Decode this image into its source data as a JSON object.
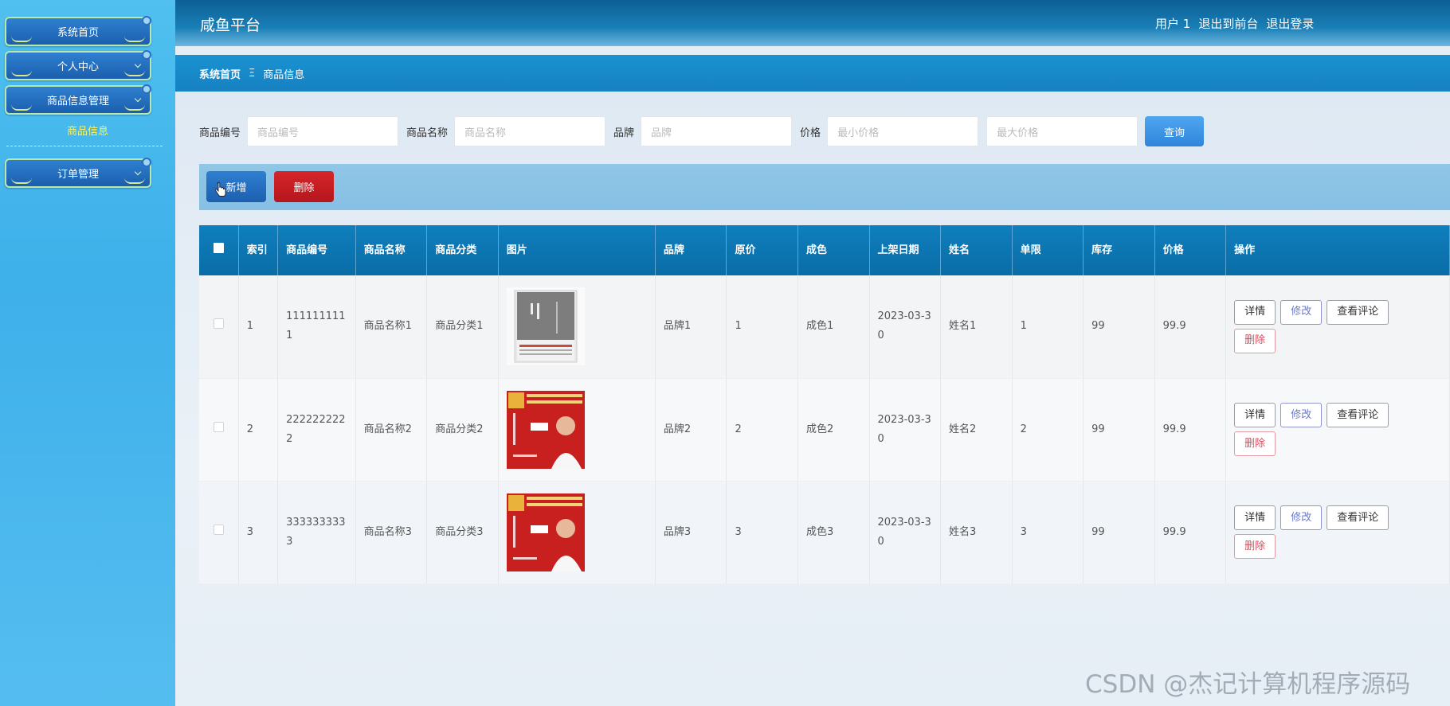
{
  "sidebar": {
    "items": [
      {
        "label": "系统首页"
      },
      {
        "label": "个人中心"
      },
      {
        "label": "商品信息管理"
      },
      {
        "label": "订单管理"
      }
    ],
    "submenu": {
      "label": "商品信息"
    }
  },
  "header": {
    "title": "咸鱼平台",
    "user": "用户 1",
    "to_front": "退出到前台",
    "logout": "退出登录"
  },
  "breadcrumb": {
    "home": "系统首页",
    "separator": "Ξ",
    "current": "商品信息"
  },
  "search": {
    "code_label": "商品编号",
    "code_placeholder": "商品编号",
    "name_label": "商品名称",
    "name_placeholder": "商品名称",
    "brand_label": "品牌",
    "brand_placeholder": "品牌",
    "price_label": "价格",
    "min_placeholder": "最小价格",
    "max_placeholder": "最大价格",
    "query_label": "查询"
  },
  "actions": {
    "add_label": "新增",
    "delete_label": "删除"
  },
  "table": {
    "headers": {
      "index": "索引",
      "code": "商品编号",
      "name": "商品名称",
      "category": "商品分类",
      "image": "图片",
      "brand": "品牌",
      "orig_price": "原价",
      "condition": "成色",
      "list_date": "上架日期",
      "seller": "姓名",
      "limit": "单限",
      "stock": "库存",
      "price": "价格",
      "ops": "操作"
    },
    "rows": [
      {
        "index": "1",
        "code": "1111111111",
        "name": "商品名称1",
        "category": "商品分类1",
        "image": "grey-book-cover",
        "brand": "品牌1",
        "orig_price": "1",
        "condition": "成色1",
        "list_date": "2023-03-30",
        "seller": "姓名1",
        "limit": "1",
        "stock": "99",
        "price": "99.9"
      },
      {
        "index": "2",
        "code": "2222222222",
        "name": "商品名称2",
        "category": "商品分类2",
        "image": "red-book-cover",
        "brand": "品牌2",
        "orig_price": "2",
        "condition": "成色2",
        "list_date": "2023-03-30",
        "seller": "姓名2",
        "limit": "2",
        "stock": "99",
        "price": "99.9"
      },
      {
        "index": "3",
        "code": "3333333333",
        "name": "商品名称3",
        "category": "商品分类3",
        "image": "red-book-cover",
        "brand": "品牌3",
        "orig_price": "3",
        "condition": "成色3",
        "list_date": "2023-03-30",
        "seller": "姓名3",
        "limit": "3",
        "stock": "99",
        "price": "99.9"
      }
    ],
    "row_actions": {
      "detail": "详情",
      "edit": "修改",
      "comments": "查看评论",
      "remove": "删除"
    }
  },
  "watermark": "CSDN @杰记计算机程序源码",
  "colors": {
    "header_bg": "#0b5f95",
    "crumb_bg": "#1a92d2",
    "sidebar_bg": "#4fc0ef",
    "add_btn": "#2f7fd0",
    "delete_btn": "#d5262b",
    "query_btn": "#4fa6ef",
    "table_header": "#0f7fbd",
    "submenu_text": "#f4f56a"
  }
}
